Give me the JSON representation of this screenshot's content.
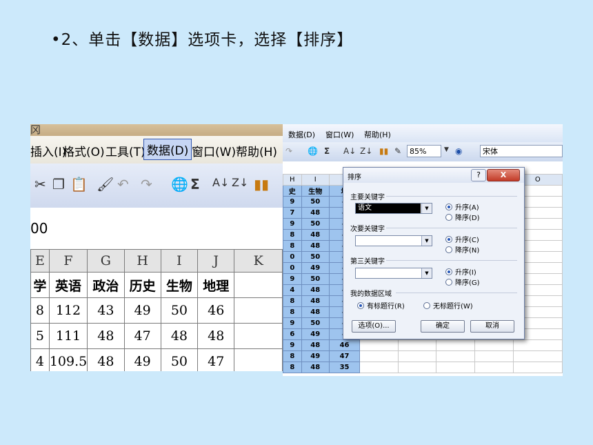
{
  "slide": {
    "title": "•2、单击【数据】选项卡，选择【排序】"
  },
  "left_shot": {
    "title_fragment": "冈",
    "menu": [
      "插入(I)",
      "格式(O)",
      "工具(T)",
      "数据(D)",
      "窗口(W)",
      "帮助(H)"
    ],
    "selected_menu": "数据(D)",
    "toolbar_icons": [
      "cut-icon",
      "copy-icon",
      "paste-icon",
      "format-painter-icon",
      "undo-icon",
      "redo-icon",
      "hyperlink-icon",
      "autosum-icon",
      "sort-ascending-icon",
      "sort-descending-icon",
      "chart-icon"
    ],
    "formula_fragment": "00",
    "columns": [
      "E",
      "F",
      "G",
      "H",
      "I",
      "J",
      "K"
    ],
    "subjects": [
      "学",
      "英语",
      "政治",
      "历史",
      "生物",
      "地理",
      ""
    ],
    "rows": [
      [
        "8",
        "112",
        "43",
        "49",
        "50",
        "46",
        ""
      ],
      [
        "5",
        "111",
        "48",
        "47",
        "48",
        "48",
        ""
      ],
      [
        "4",
        "109.5",
        "48",
        "49",
        "50",
        "47",
        ""
      ]
    ]
  },
  "right_shot": {
    "menu": [
      "数据(D)",
      "窗口(W)",
      "帮助(H)"
    ],
    "zoom": "85%",
    "font": "宋体",
    "columns": [
      "H",
      "I",
      "",
      "",
      "",
      "",
      "",
      "O"
    ],
    "subjects": [
      "史",
      "生物",
      "地"
    ],
    "rows": [
      [
        "9",
        "50",
        "4"
      ],
      [
        "7",
        "48",
        "4"
      ],
      [
        "9",
        "50",
        "4"
      ],
      [
        "8",
        "48",
        "4"
      ],
      [
        "8",
        "48",
        "4"
      ],
      [
        "0",
        "50",
        "4"
      ],
      [
        "0",
        "49",
        "4"
      ],
      [
        "9",
        "50",
        "4"
      ],
      [
        "4",
        "48",
        "4"
      ],
      [
        "8",
        "48",
        "4"
      ],
      [
        "8",
        "48",
        "4"
      ],
      [
        "9",
        "50",
        "4"
      ],
      [
        "6",
        "49",
        "4"
      ],
      [
        "9",
        "48",
        "46"
      ],
      [
        "8",
        "49",
        "47"
      ],
      [
        "8",
        "48",
        "35"
      ]
    ],
    "dialog": {
      "title": "排序",
      "help": "?",
      "close": "X",
      "primary_label": "主要关键字",
      "primary_value": "语文",
      "secondary_label": "次要关键字",
      "secondary_value": "",
      "third_label": "第三关键字",
      "third_value": "",
      "asc1": "升序(A)",
      "desc1": "降序(D)",
      "asc2": "升序(C)",
      "desc2": "降序(N)",
      "asc3": "升序(I)",
      "desc3": "降序(G)",
      "range_label": "我的数据区域",
      "has_header": "有标题行(R)",
      "no_header": "无标题行(W)",
      "options_btn": "选项(O)...",
      "ok_btn": "确定",
      "cancel_btn": "取消"
    }
  }
}
